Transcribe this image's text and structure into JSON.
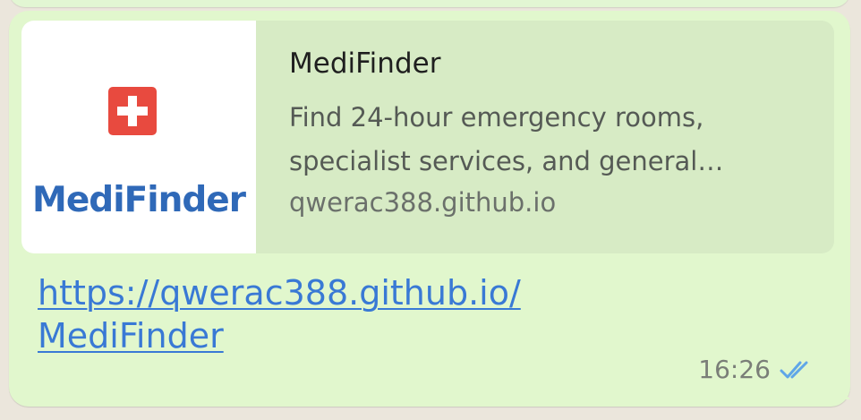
{
  "message": {
    "link_preview": {
      "thumbnail": {
        "logo_text": "MediFinder",
        "icon": "medical-cross-icon",
        "icon_color": "#e84a3f",
        "text_color": "#2f69b8"
      },
      "title": "MediFinder",
      "description_line_1": "Find 24-hour emergency rooms,",
      "description_line_2": "specialist services, and general…",
      "domain": "qwerac388.github.io"
    },
    "link_line_1": "https://qwerac388.github.io/",
    "link_line_2": "MediFinder",
    "time": "16:26",
    "status_icon": "double-check-icon",
    "status_color": "#5fa6e8"
  },
  "colors": {
    "bubble": "#e1f7cd",
    "preview_card": "#d7ebc5",
    "link": "#3979d5"
  }
}
